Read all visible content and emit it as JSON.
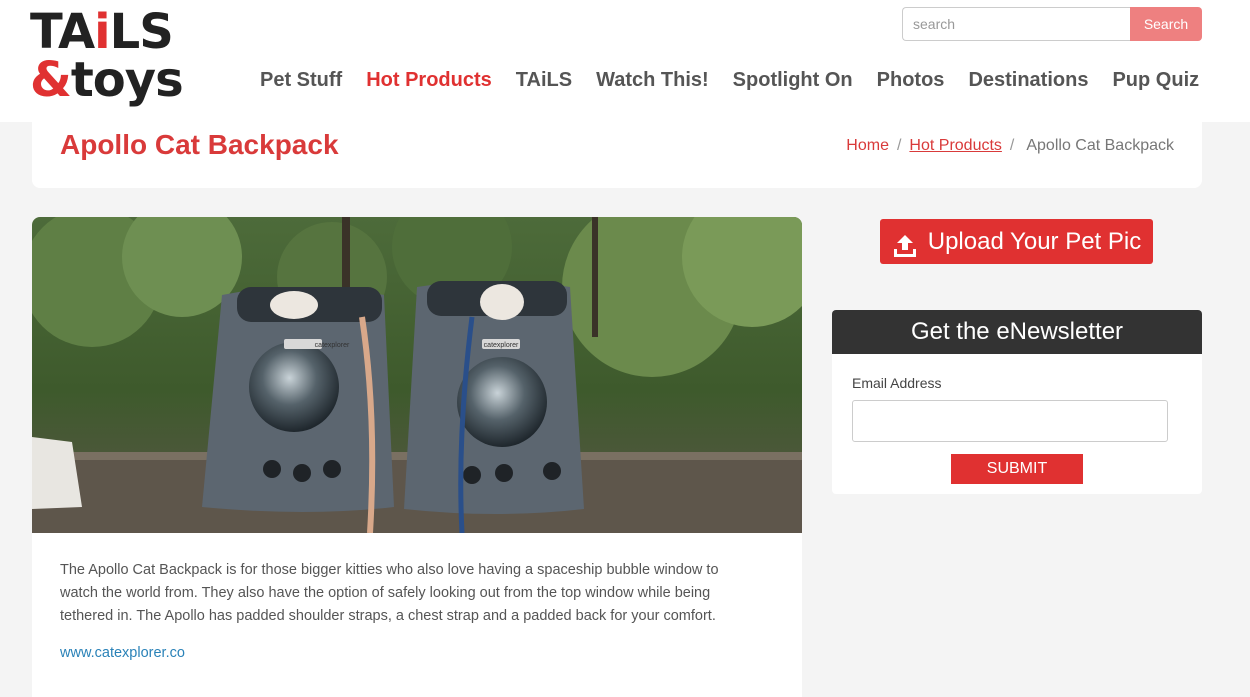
{
  "logo": {
    "line1_a": "TA",
    "line1_i": "i",
    "line1_b": "LS",
    "amp": "&",
    "line2": "toys"
  },
  "search": {
    "placeholder": "search",
    "button_label": "Search"
  },
  "nav": {
    "items": [
      {
        "label": "Pet Stuff"
      },
      {
        "label": "Hot Products"
      },
      {
        "label": "TAiLS"
      },
      {
        "label": "Watch This!"
      },
      {
        "label": "Spotlight On"
      },
      {
        "label": "Photos"
      },
      {
        "label": "Destinations"
      },
      {
        "label": "Pup Quiz"
      }
    ],
    "active": "Hot Products"
  },
  "page": {
    "title": "Apollo Cat Backpack"
  },
  "breadcrumb": {
    "home": "Home",
    "sep": "/",
    "section": "Hot Products",
    "current": "Apollo Cat Backpack"
  },
  "article": {
    "description": "The Apollo Cat Backpack is for those bigger kitties who also love having a spaceship bubble window to watch the world from. They also have the option of safely looking out from the top window while being tethered in. The Apollo has padded shoulder straps, a chest strap and a padded back for your comfort.",
    "link": "www.catexplorer.co",
    "image_brand_text": "catexplorer"
  },
  "sidebar": {
    "upload_label": "Upload Your Pet Pic",
    "newsletter_title": "Get the eNewsletter",
    "email_label": "Email Address",
    "submit_label": "SUBMIT"
  },
  "colors": {
    "accent": "#e03131",
    "search_button": "#ee8080",
    "link": "#2a82b8",
    "dark_header": "#333333"
  }
}
